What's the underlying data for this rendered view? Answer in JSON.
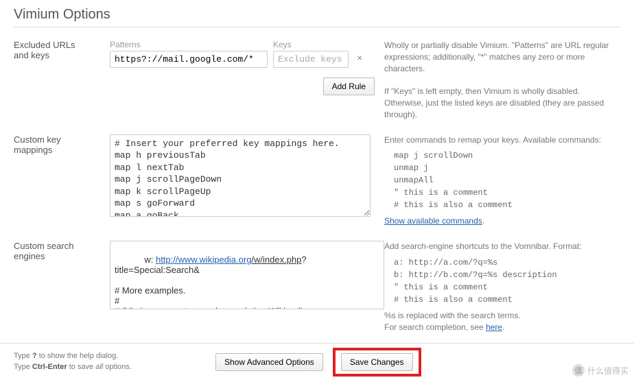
{
  "title": "Vimium Options",
  "excluded": {
    "section_label_1": "Excluded URLs",
    "section_label_2": "and keys",
    "patterns_label": "Patterns",
    "keys_label": "Keys",
    "pattern_value": "https?://mail.google.com/*",
    "keys_placeholder": "Exclude keys",
    "add_rule": "Add Rule",
    "help_1": "Wholly or partially disable Vimium. \"Patterns\" are URL regular expressions; additionally, \"*\" matches any zero or more characters.",
    "help_2": "If \"Keys\" is left empty, then Vimium is wholly disabled. Otherwise, just the listed keys are disabled (they are passed through)."
  },
  "mappings": {
    "section_label_1": "Custom key",
    "section_label_2": "mappings",
    "value": "# Insert your preferred key mappings here.\nmap h previousTab\nmap l nextTab\nmap j scrollPageDown\nmap k scrollPageUp\nmap s goForward\nmap a goBack",
    "help_intro": "Enter commands to remap your keys. Available commands:",
    "help_code": "map j scrollDown\nunmap j\nunmapAll\n\" this is a comment\n# this is also a comment",
    "show_link": "Show available commands"
  },
  "engines": {
    "section_label_1": "Custom search",
    "section_label_2": "engines",
    "prefix": "w: ",
    "link_host": "http://www.wikipedia.org",
    "link_path": "/w/index.php",
    "suffix": "?title=Special:Search&",
    "body": "\n# More examples.\n#\n# (Vimium supports search completion Wikipedia, as\n# above, and for these.)\n#",
    "help_intro": "Add search-engine shortcuts to the Vomnibar. Format:",
    "help_code": "a: http://a.com/?q=%s\nb: http://b.com/?q=%s description\n\" this is a comment\n# this is also a comment",
    "help_out_1": "%s is replaced with the search terms.",
    "help_out_2a": "For search completion, see ",
    "help_out_2b": "here",
    "help_out_2c": "."
  },
  "footer": {
    "line1a": "Type ",
    "line1b": "?",
    "line1c": " to show the help dialog.",
    "line2a": "Type ",
    "line2b": "Ctrl-Enter",
    "line2c": " to save ",
    "line2d": "all",
    "line2e": " options.",
    "adv": "Show Advanced Options",
    "save": "Save Changes"
  },
  "watermark": {
    "icon": "值",
    "text": "什么值得买"
  }
}
